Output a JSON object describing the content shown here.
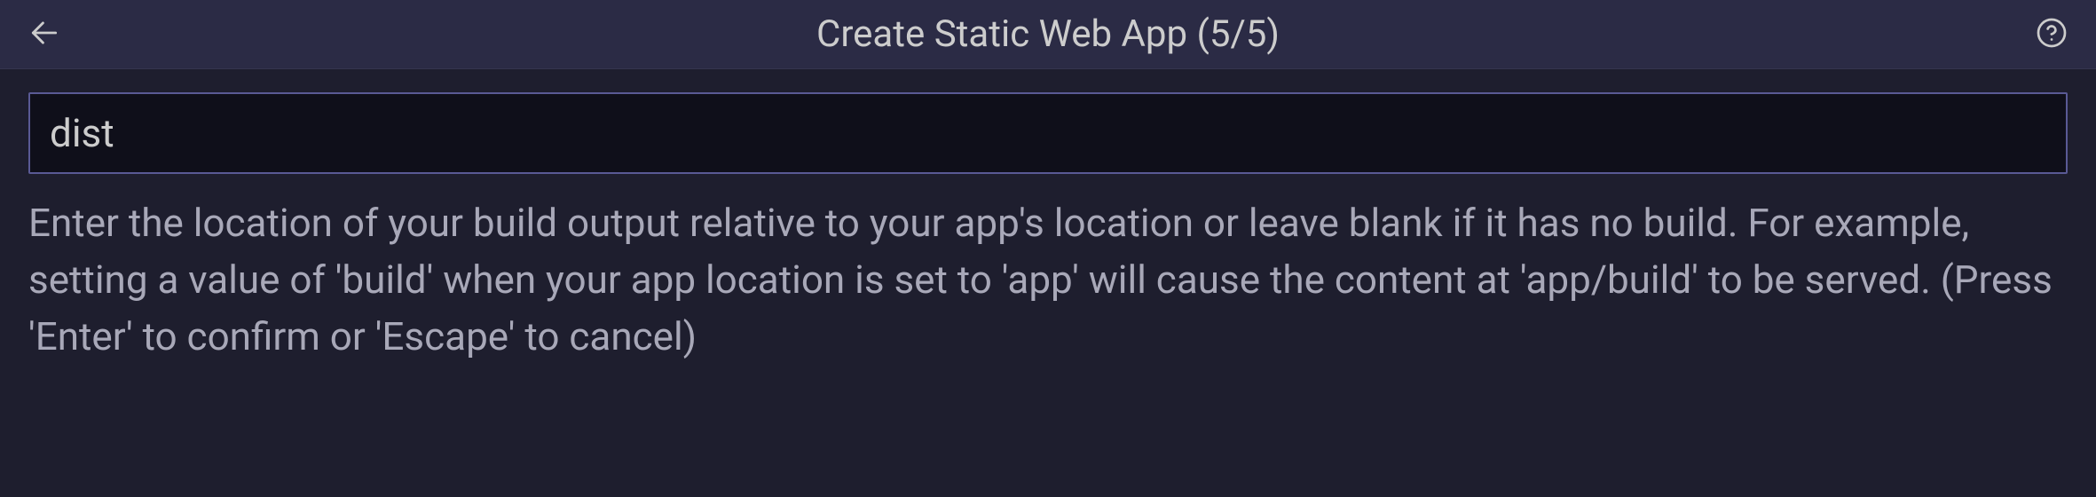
{
  "header": {
    "title": "Create Static Web App (5/5)"
  },
  "form": {
    "input_value": "dist",
    "description": "Enter the location of your build output relative to your app's location or leave blank if it has no build. For example, setting a value of 'build' when your app location is set to 'app' will cause the content at 'app/build' to be served. (Press 'Enter' to confirm or 'Escape' to cancel)"
  }
}
